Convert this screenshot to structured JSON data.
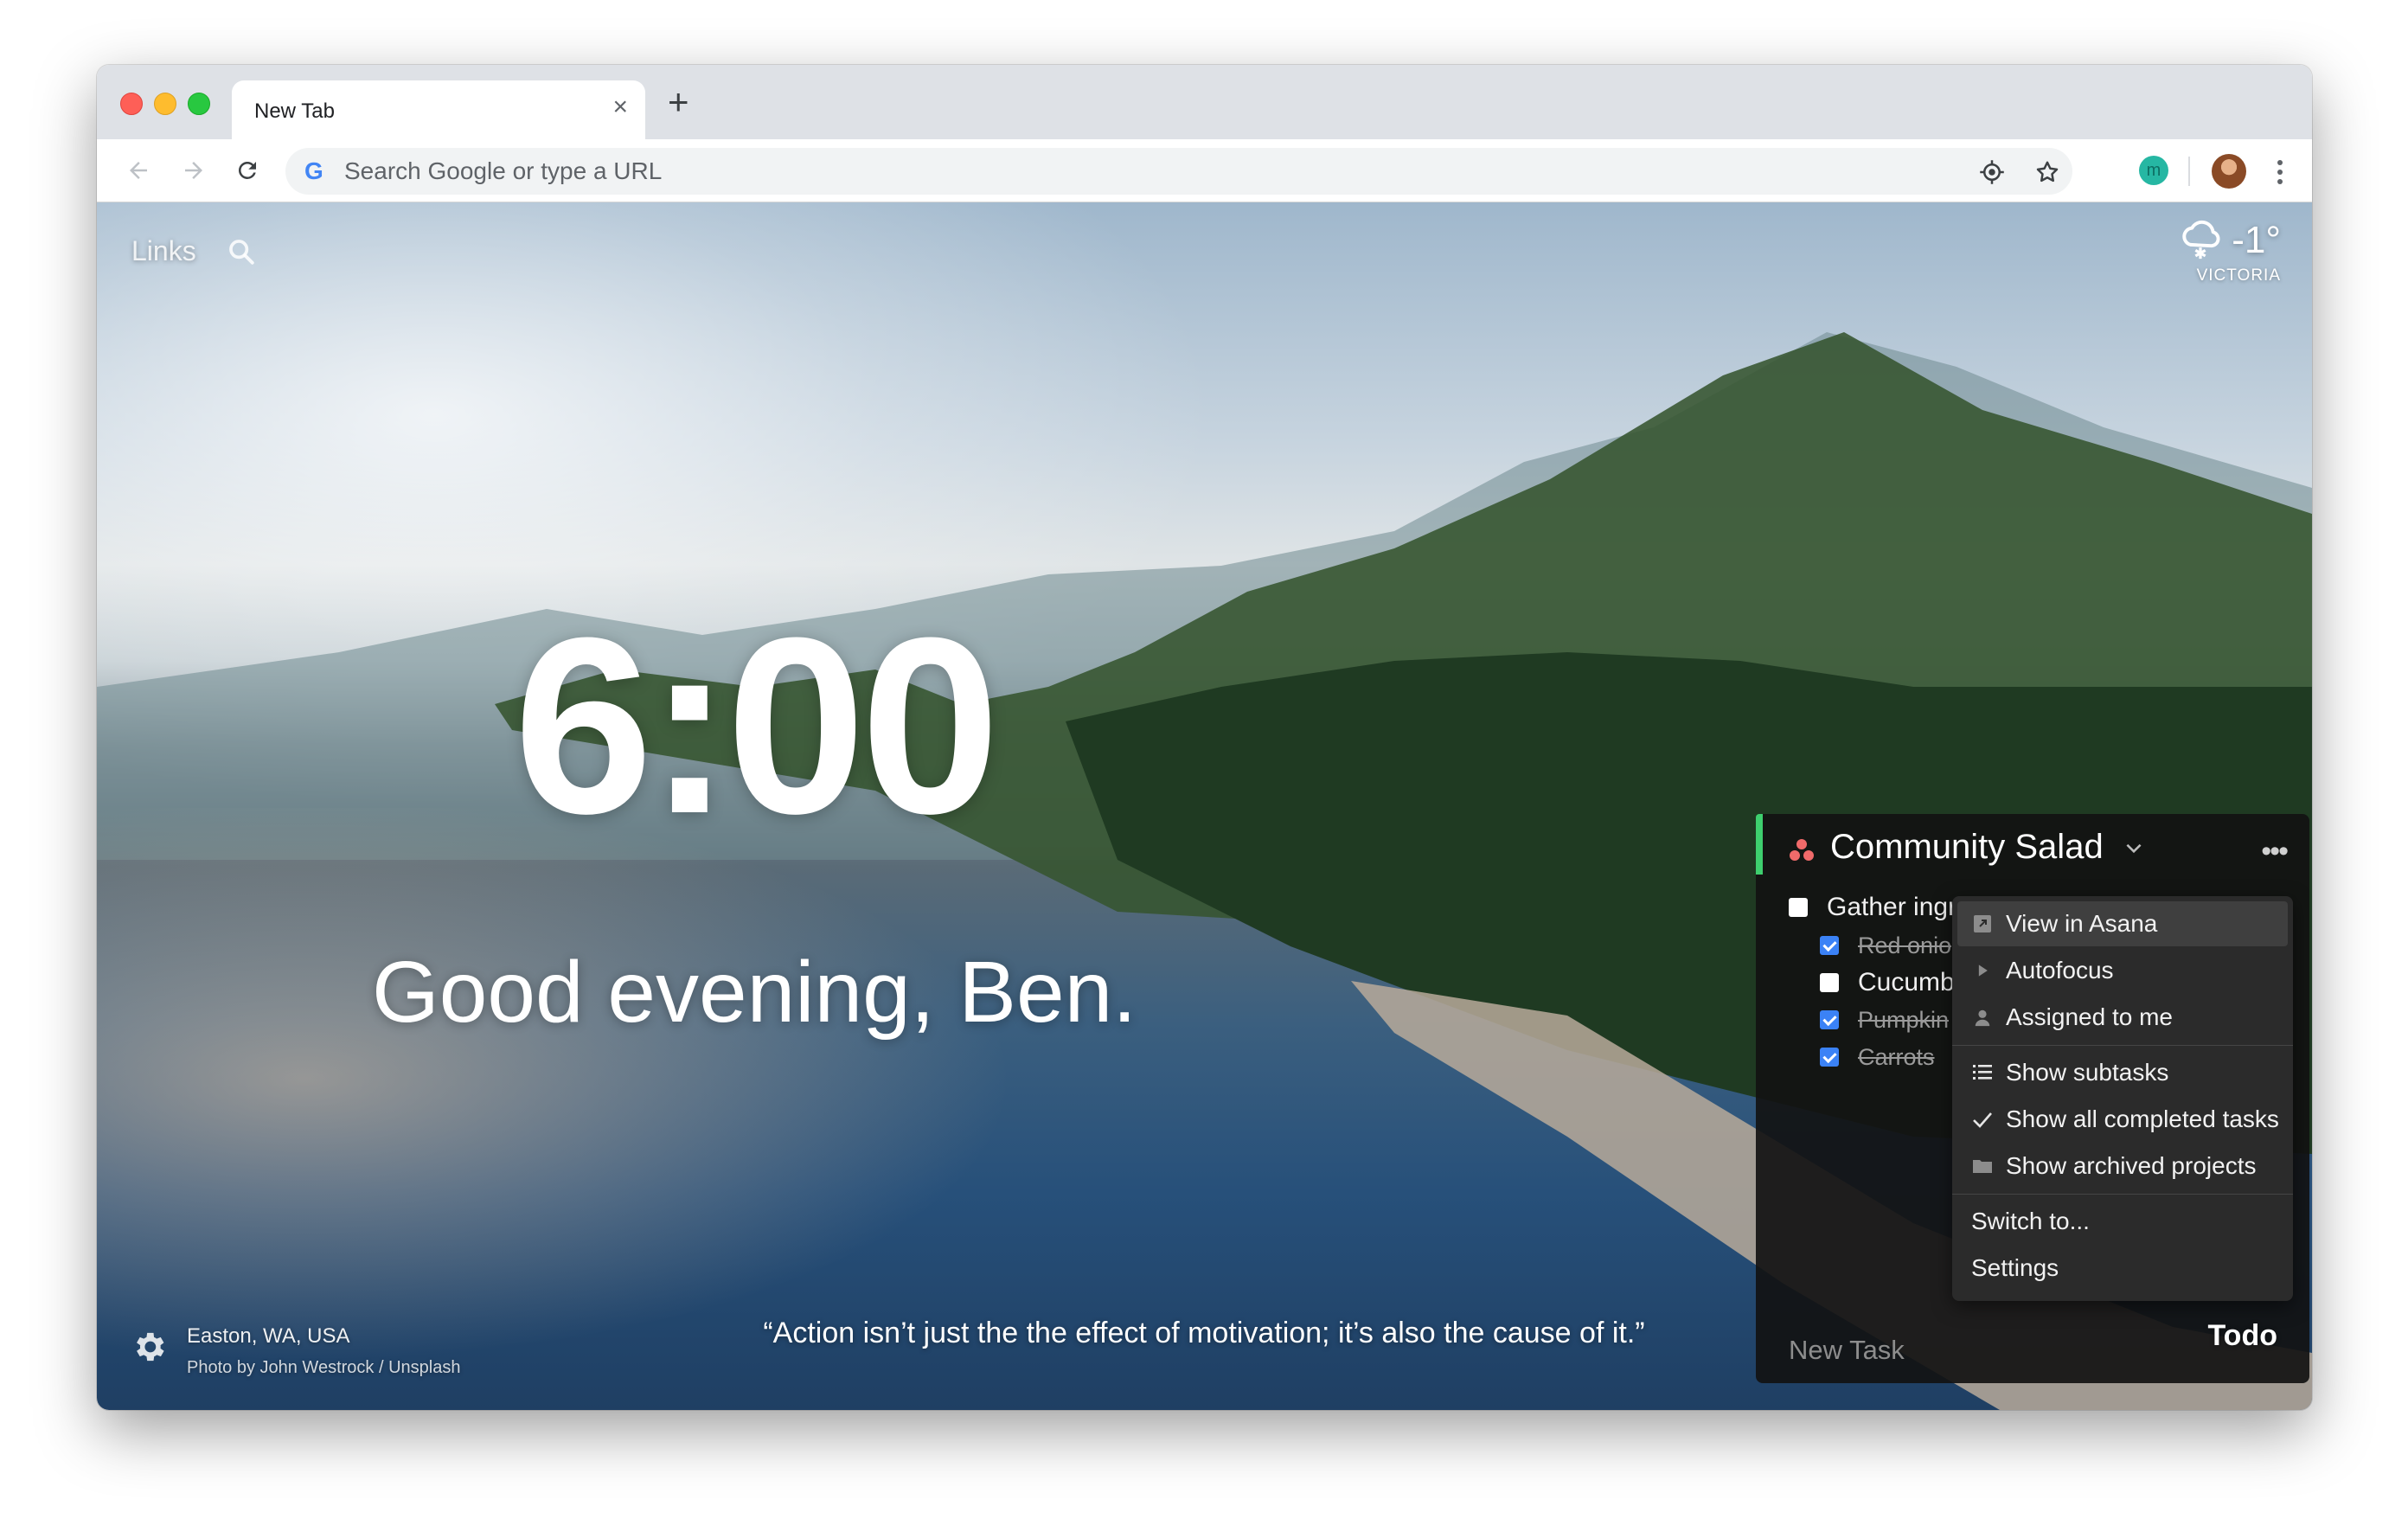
{
  "browser": {
    "tab_title": "New Tab",
    "close_glyph": "×",
    "new_tab_glyph": "+",
    "omnibox_placeholder": "Search Google or type a URL",
    "google_glyph": "G",
    "extension_glyph": "m"
  },
  "dashboard": {
    "links_label": "Links",
    "weather": {
      "temperature": "-1°",
      "location": "VICTORIA",
      "icon": "snow-cloud-icon"
    },
    "clock": "6:00",
    "greeting": "Good evening, Ben.",
    "quote": "“Action isn’t just the the effect of motivation; it’s also the cause of it.”",
    "photo": {
      "location": "Easton, WA, USA",
      "credit": "Photo by John Westrock / Unsplash"
    },
    "todo_label": "Todo"
  },
  "todo": {
    "project": "Community Salad",
    "more_glyph": "•••",
    "tasks": [
      {
        "text": "Gather ingr",
        "done": false
      },
      {
        "text": "Red onio",
        "done": true
      },
      {
        "text": "Cucumbe",
        "done": false
      },
      {
        "text": "Pumpkin",
        "done": true
      },
      {
        "text": "Carrots",
        "done": true
      }
    ],
    "new_task_placeholder": "New Task"
  },
  "menu": {
    "items": [
      {
        "label": "View in Asana",
        "icon": "external-link-icon",
        "highlighted": true
      },
      {
        "label": "Autofocus",
        "icon": "play-icon"
      },
      {
        "label": "Assigned to me",
        "icon": "person-icon"
      },
      {
        "label": "Show subtasks",
        "icon": "list-icon"
      },
      {
        "label": "Show all completed tasks",
        "icon": "check-icon"
      },
      {
        "label": "Show archived projects",
        "icon": "folder-icon"
      },
      {
        "label": "Switch to..."
      },
      {
        "label": "Settings"
      }
    ]
  },
  "colors": {
    "accent_green": "#3ecf6e",
    "checkbox_blue": "#3b82f6",
    "asana_coral": "#f06a6a"
  }
}
